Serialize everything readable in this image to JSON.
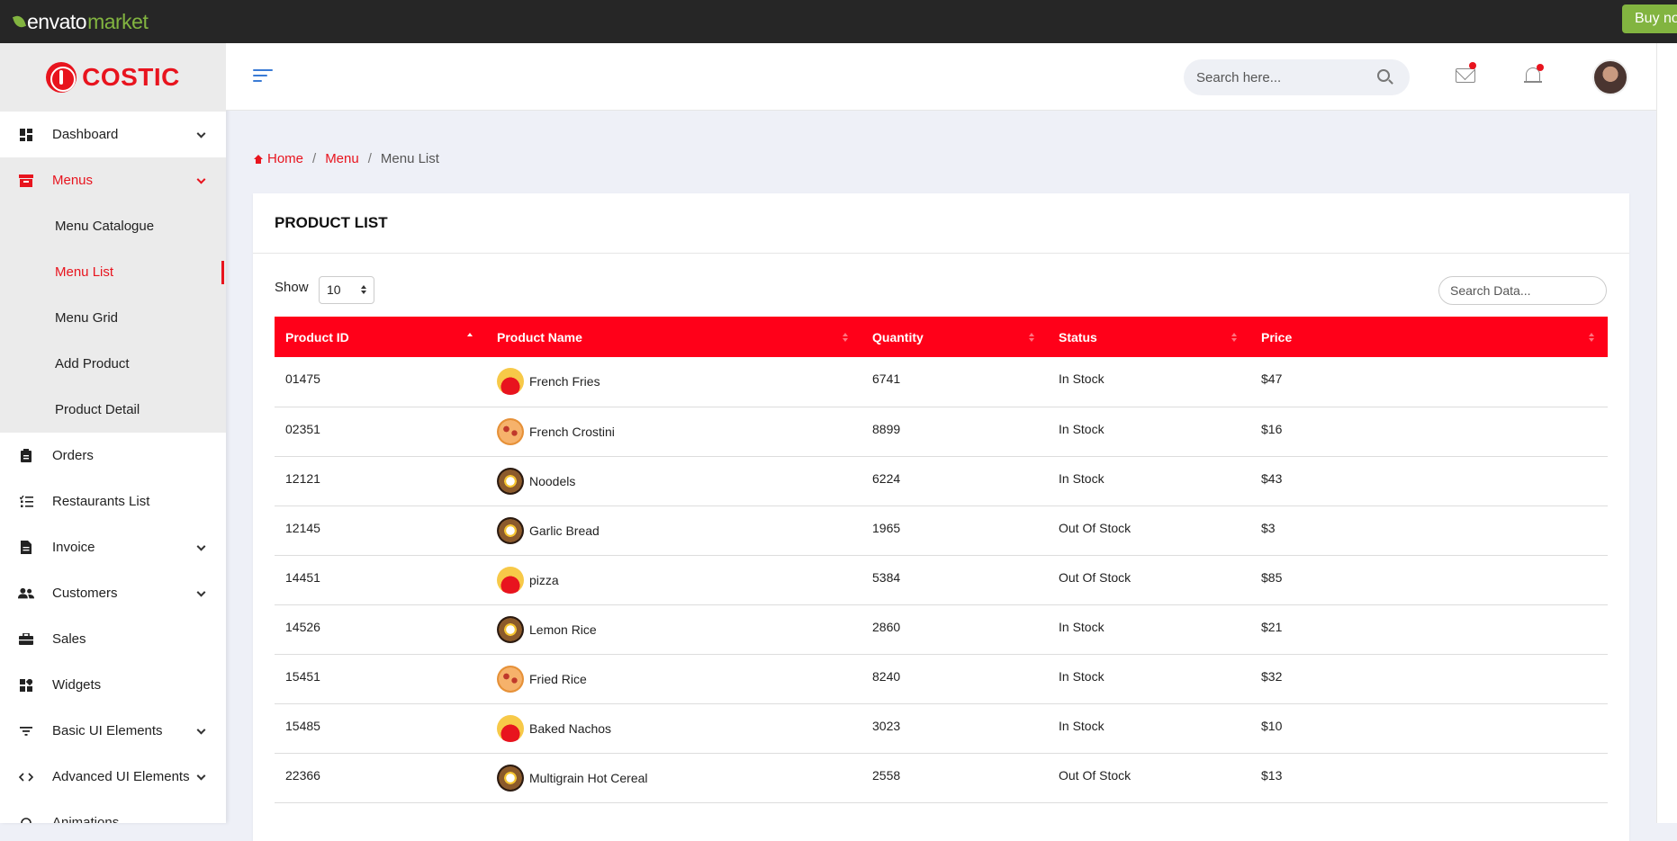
{
  "envato": {
    "brand": "envato",
    "brand_suffix": "market",
    "buy_label": "Buy now"
  },
  "app": {
    "name": "COSTIC"
  },
  "sidebar": {
    "items": [
      {
        "label": "Dashboard",
        "icon": "dashboard-icon",
        "has_children": true
      },
      {
        "label": "Menus",
        "icon": "menus-icon",
        "has_children": true,
        "active": true,
        "children": [
          {
            "label": "Menu Catalogue"
          },
          {
            "label": "Menu List",
            "active": true
          },
          {
            "label": "Menu Grid"
          },
          {
            "label": "Add Product"
          },
          {
            "label": "Product Detail"
          }
        ]
      },
      {
        "label": "Orders",
        "icon": "clipboard-icon",
        "has_children": false
      },
      {
        "label": "Restaurants List",
        "icon": "list-icon",
        "has_children": false
      },
      {
        "label": "Invoice",
        "icon": "document-icon",
        "has_children": true
      },
      {
        "label": "Customers",
        "icon": "users-icon",
        "has_children": true
      },
      {
        "label": "Sales",
        "icon": "briefcase-icon",
        "has_children": false
      },
      {
        "label": "Widgets",
        "icon": "widgets-icon",
        "has_children": false
      },
      {
        "label": "Basic UI Elements",
        "icon": "filter-icon",
        "has_children": true
      },
      {
        "label": "Advanced UI Elements",
        "icon": "code-icon",
        "has_children": true
      },
      {
        "label": "Animations",
        "icon": "animation-icon",
        "has_children": false
      }
    ]
  },
  "header": {
    "search_placeholder": "Search here..."
  },
  "breadcrumb": {
    "home": "Home",
    "section": "Menu",
    "current": "Menu List"
  },
  "card": {
    "title": "PRODUCT LIST",
    "show_label": "Show",
    "show_value": "10",
    "search_placeholder": "Search Data..."
  },
  "table": {
    "columns": [
      "Product ID",
      "Product Name",
      "Quantity",
      "Status",
      "Price"
    ],
    "rows": [
      {
        "id": "01475",
        "name": "French Fries",
        "thumb": "fries",
        "qty": "6741",
        "status": "In Stock",
        "price": "$47"
      },
      {
        "id": "02351",
        "name": "French Crostini",
        "thumb": "pizza",
        "qty": "8899",
        "status": "In Stock",
        "price": "$16"
      },
      {
        "id": "12121",
        "name": "Noodels",
        "thumb": "plate",
        "qty": "6224",
        "status": "In Stock",
        "price": "$43"
      },
      {
        "id": "12145",
        "name": "Garlic Bread",
        "thumb": "plate",
        "qty": "1965",
        "status": "Out Of Stock",
        "price": "$3"
      },
      {
        "id": "14451",
        "name": "pizza",
        "thumb": "fries",
        "qty": "5384",
        "status": "Out Of Stock",
        "price": "$85"
      },
      {
        "id": "14526",
        "name": "Lemon Rice",
        "thumb": "plate",
        "qty": "2860",
        "status": "In Stock",
        "price": "$21"
      },
      {
        "id": "15451",
        "name": "Fried Rice",
        "thumb": "pizza",
        "qty": "8240",
        "status": "In Stock",
        "price": "$32"
      },
      {
        "id": "15485",
        "name": "Baked Nachos",
        "thumb": "fries",
        "qty": "3023",
        "status": "In Stock",
        "price": "$10"
      },
      {
        "id": "22366",
        "name": "Multigrain Hot Cereal",
        "thumb": "plate",
        "qty": "2558",
        "status": "Out Of Stock",
        "price": "$13"
      }
    ]
  },
  "colors": {
    "accent": "#e8141e",
    "header_row": "#ff0019",
    "envato_green": "#82b440",
    "topbar": "#262626"
  }
}
